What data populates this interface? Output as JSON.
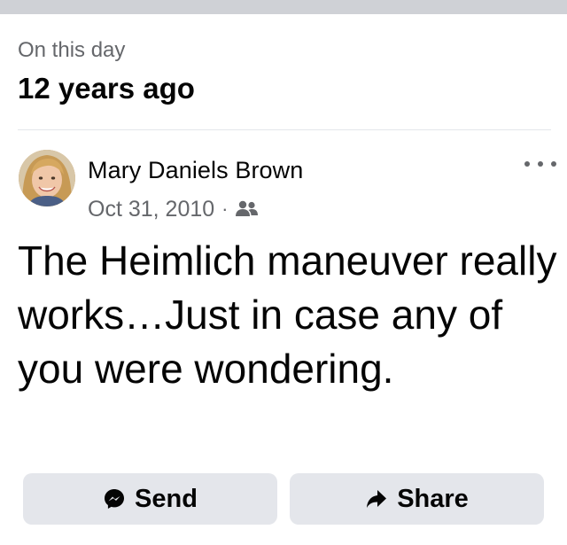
{
  "memory_header": {
    "label": "On this day",
    "title": "12 years ago"
  },
  "post": {
    "author_name": "Mary Daniels Brown",
    "date": "Oct 31, 2010",
    "separator": "·",
    "audience_icon": "friends-icon",
    "more_icon": "more-options-icon",
    "text": "The Heimlich maneuver really works…Just in case any of you were wondering."
  },
  "actions": {
    "send_label": "Send",
    "send_icon": "messenger-icon",
    "share_label": "Share",
    "share_icon": "share-arrow-icon"
  },
  "colors": {
    "secondary_text": "#65676b",
    "button_bg": "#e4e6eb",
    "divider": "#cfd1d6"
  }
}
